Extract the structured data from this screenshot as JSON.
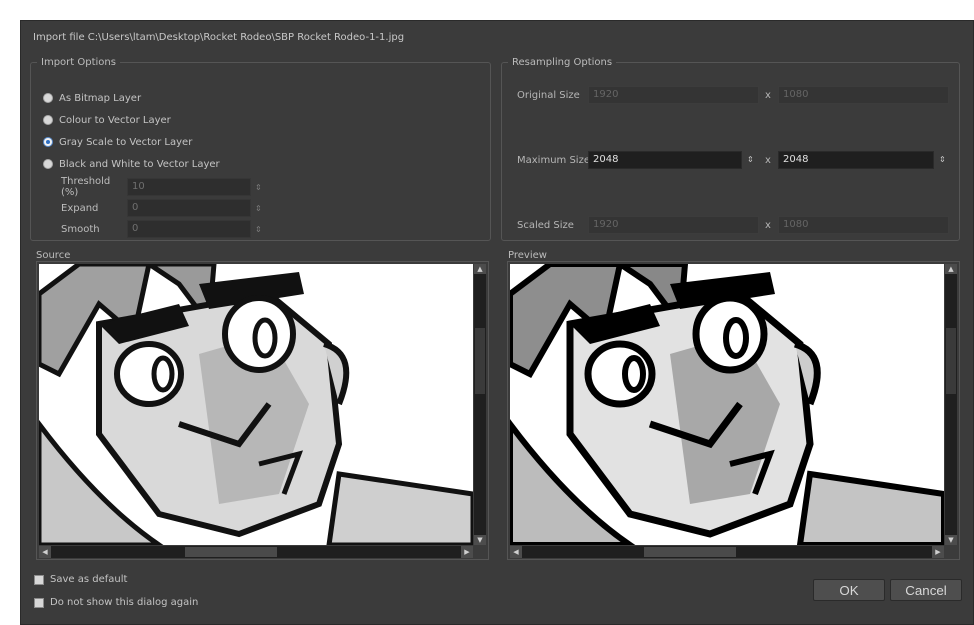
{
  "title": "Import file C:\\Users\\ltam\\Desktop\\Rocket Rodeo\\SBP Rocket Rodeo-1-1.jpg",
  "import_options": {
    "legend": "Import Options",
    "radios": [
      {
        "label": "As Bitmap Layer",
        "checked": false
      },
      {
        "label": "Colour to Vector Layer",
        "checked": false
      },
      {
        "label": "Gray Scale to Vector Layer",
        "checked": true
      },
      {
        "label": "Black and White to Vector Layer",
        "checked": false
      }
    ],
    "threshold": {
      "label": "Threshold (%)",
      "value": "10"
    },
    "expand": {
      "label": "Expand",
      "value": "0"
    },
    "smooth": {
      "label": "Smooth",
      "value": "0"
    }
  },
  "resampling": {
    "legend": "Resampling Options",
    "original": {
      "label": "Original Size",
      "width": "1920",
      "height": "1080"
    },
    "maximum": {
      "label": "Maximum Size",
      "width": "2048",
      "height": "2048"
    },
    "scaled": {
      "label": "Scaled Size",
      "width": "1920",
      "height": "1080"
    },
    "times": "x"
  },
  "source": {
    "label": "Source"
  },
  "preview": {
    "label": "Preview"
  },
  "checkboxes": {
    "save_default": "Save as default",
    "dont_show": "Do not show this dialog again"
  },
  "buttons": {
    "ok": "OK",
    "cancel": "Cancel"
  },
  "icons": {
    "spinner": "spinner-arrows-icon",
    "scroll_up": "scroll-up-icon",
    "scroll_down": "scroll-down-icon",
    "scroll_left": "scroll-left-icon",
    "scroll_right": "scroll-right-icon"
  }
}
